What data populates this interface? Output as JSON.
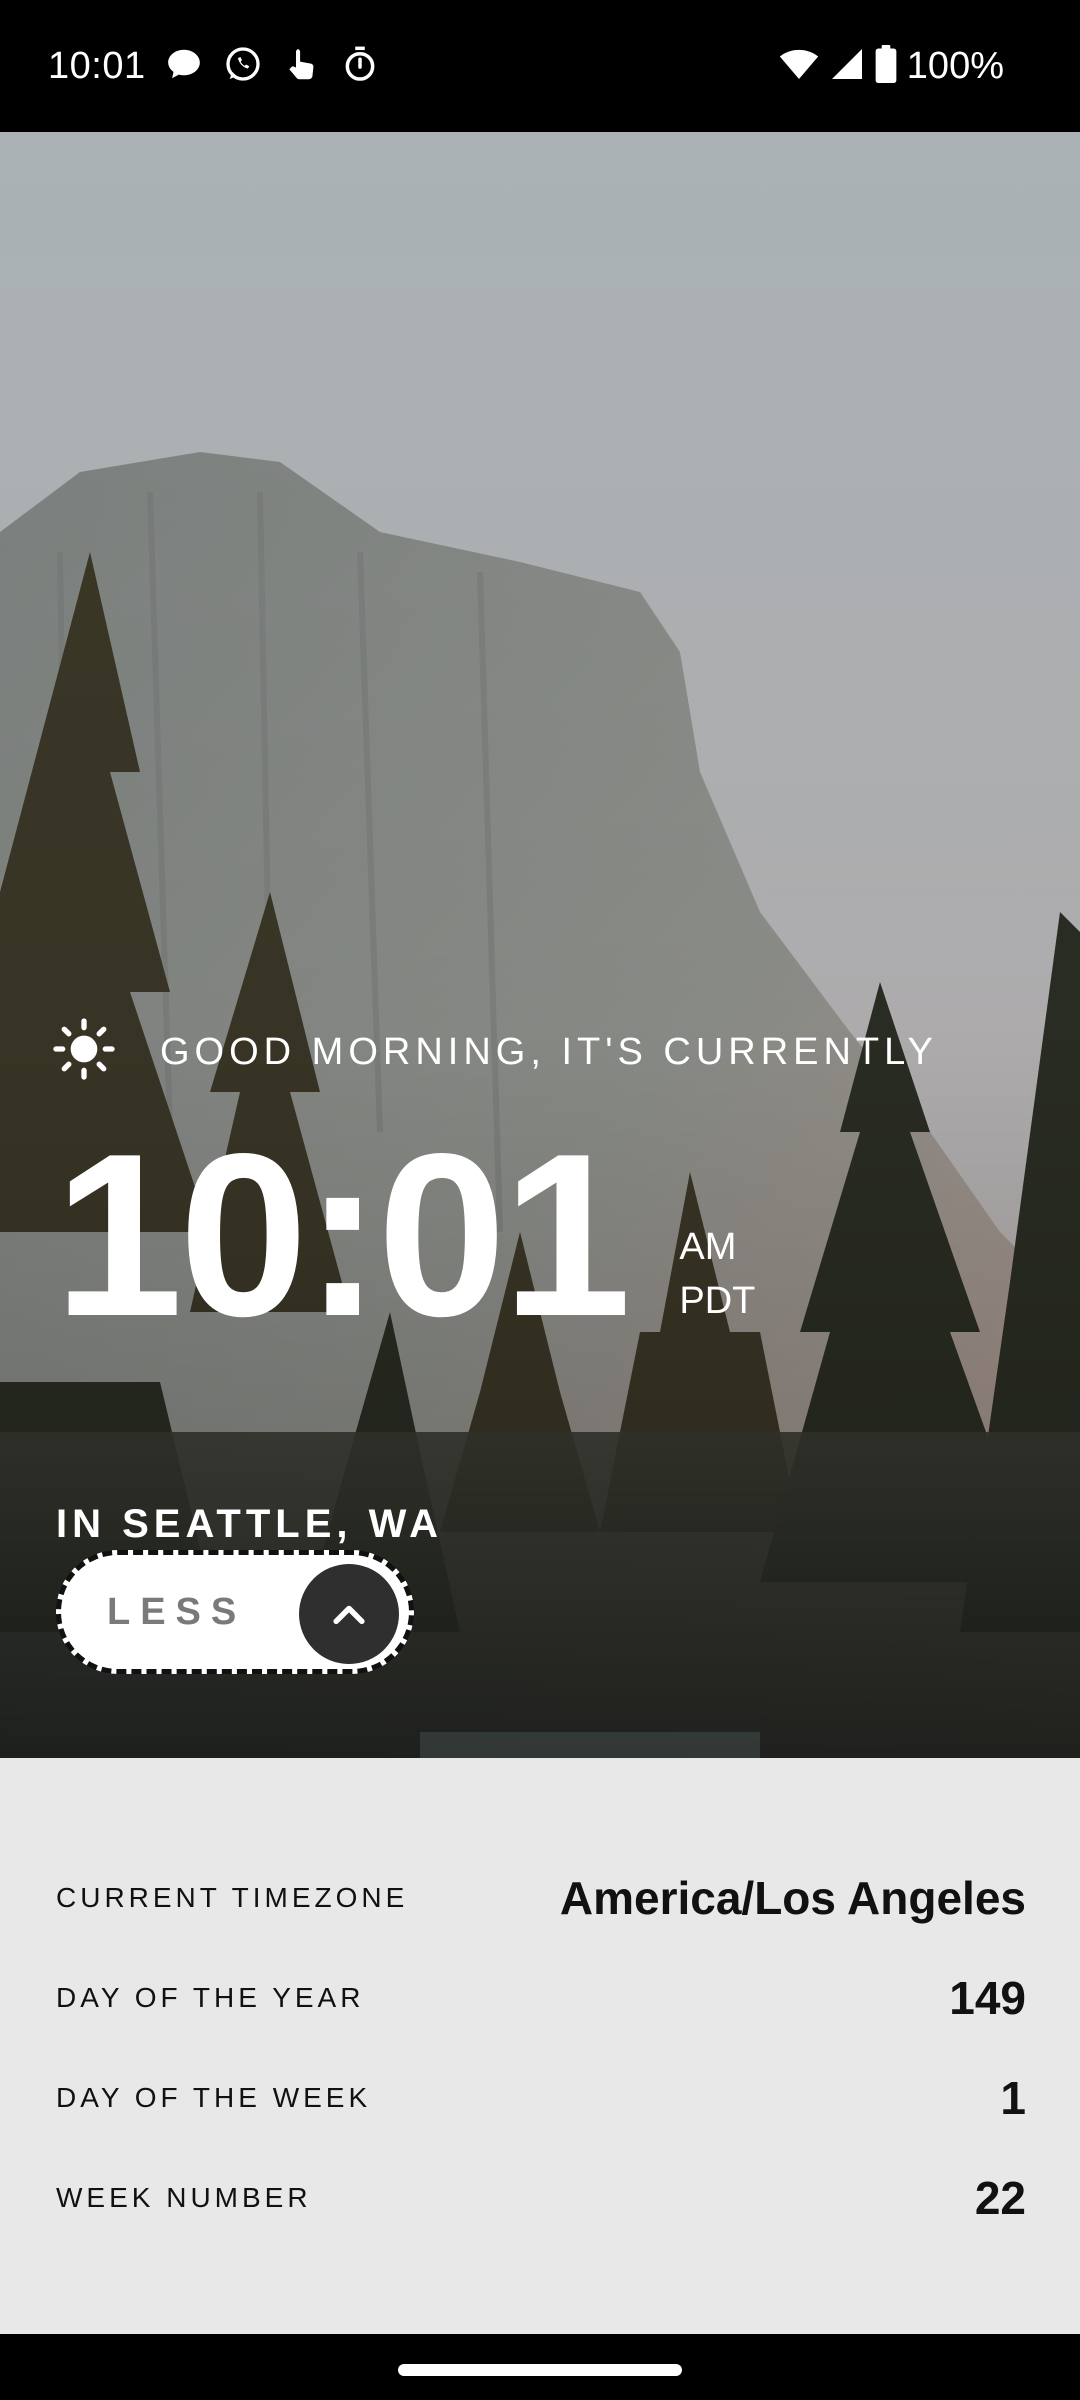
{
  "status_bar": {
    "time": "10:01",
    "battery_percent": "100%",
    "left_icons": [
      "chat-bubble-icon",
      "whatsapp-icon",
      "touch-icon",
      "timer-icon"
    ],
    "right_icons": [
      "wifi-icon",
      "signal-icon",
      "battery-icon"
    ]
  },
  "hero": {
    "weather_icon": "sun-icon",
    "greeting": "GOOD MORNING, IT'S CURRENTLY",
    "time": "10:01",
    "meridiem": "AM",
    "timezone_abbr": "PDT",
    "location": "IN SEATTLE, WA",
    "toggle_label": "LESS",
    "toggle_icon": "chevron-up-icon"
  },
  "details": [
    {
      "label": "CURRENT TIMEZONE",
      "value": "America/Los Angeles"
    },
    {
      "label": "DAY OF THE YEAR",
      "value": "149"
    },
    {
      "label": "DAY OF THE WEEK",
      "value": "1"
    },
    {
      "label": "WEEK NUMBER",
      "value": "22"
    }
  ],
  "colors": {
    "details_background": "#e8e8e8",
    "toggle_circle": "#2f2f2f",
    "toggle_label": "#7a7a7a"
  }
}
